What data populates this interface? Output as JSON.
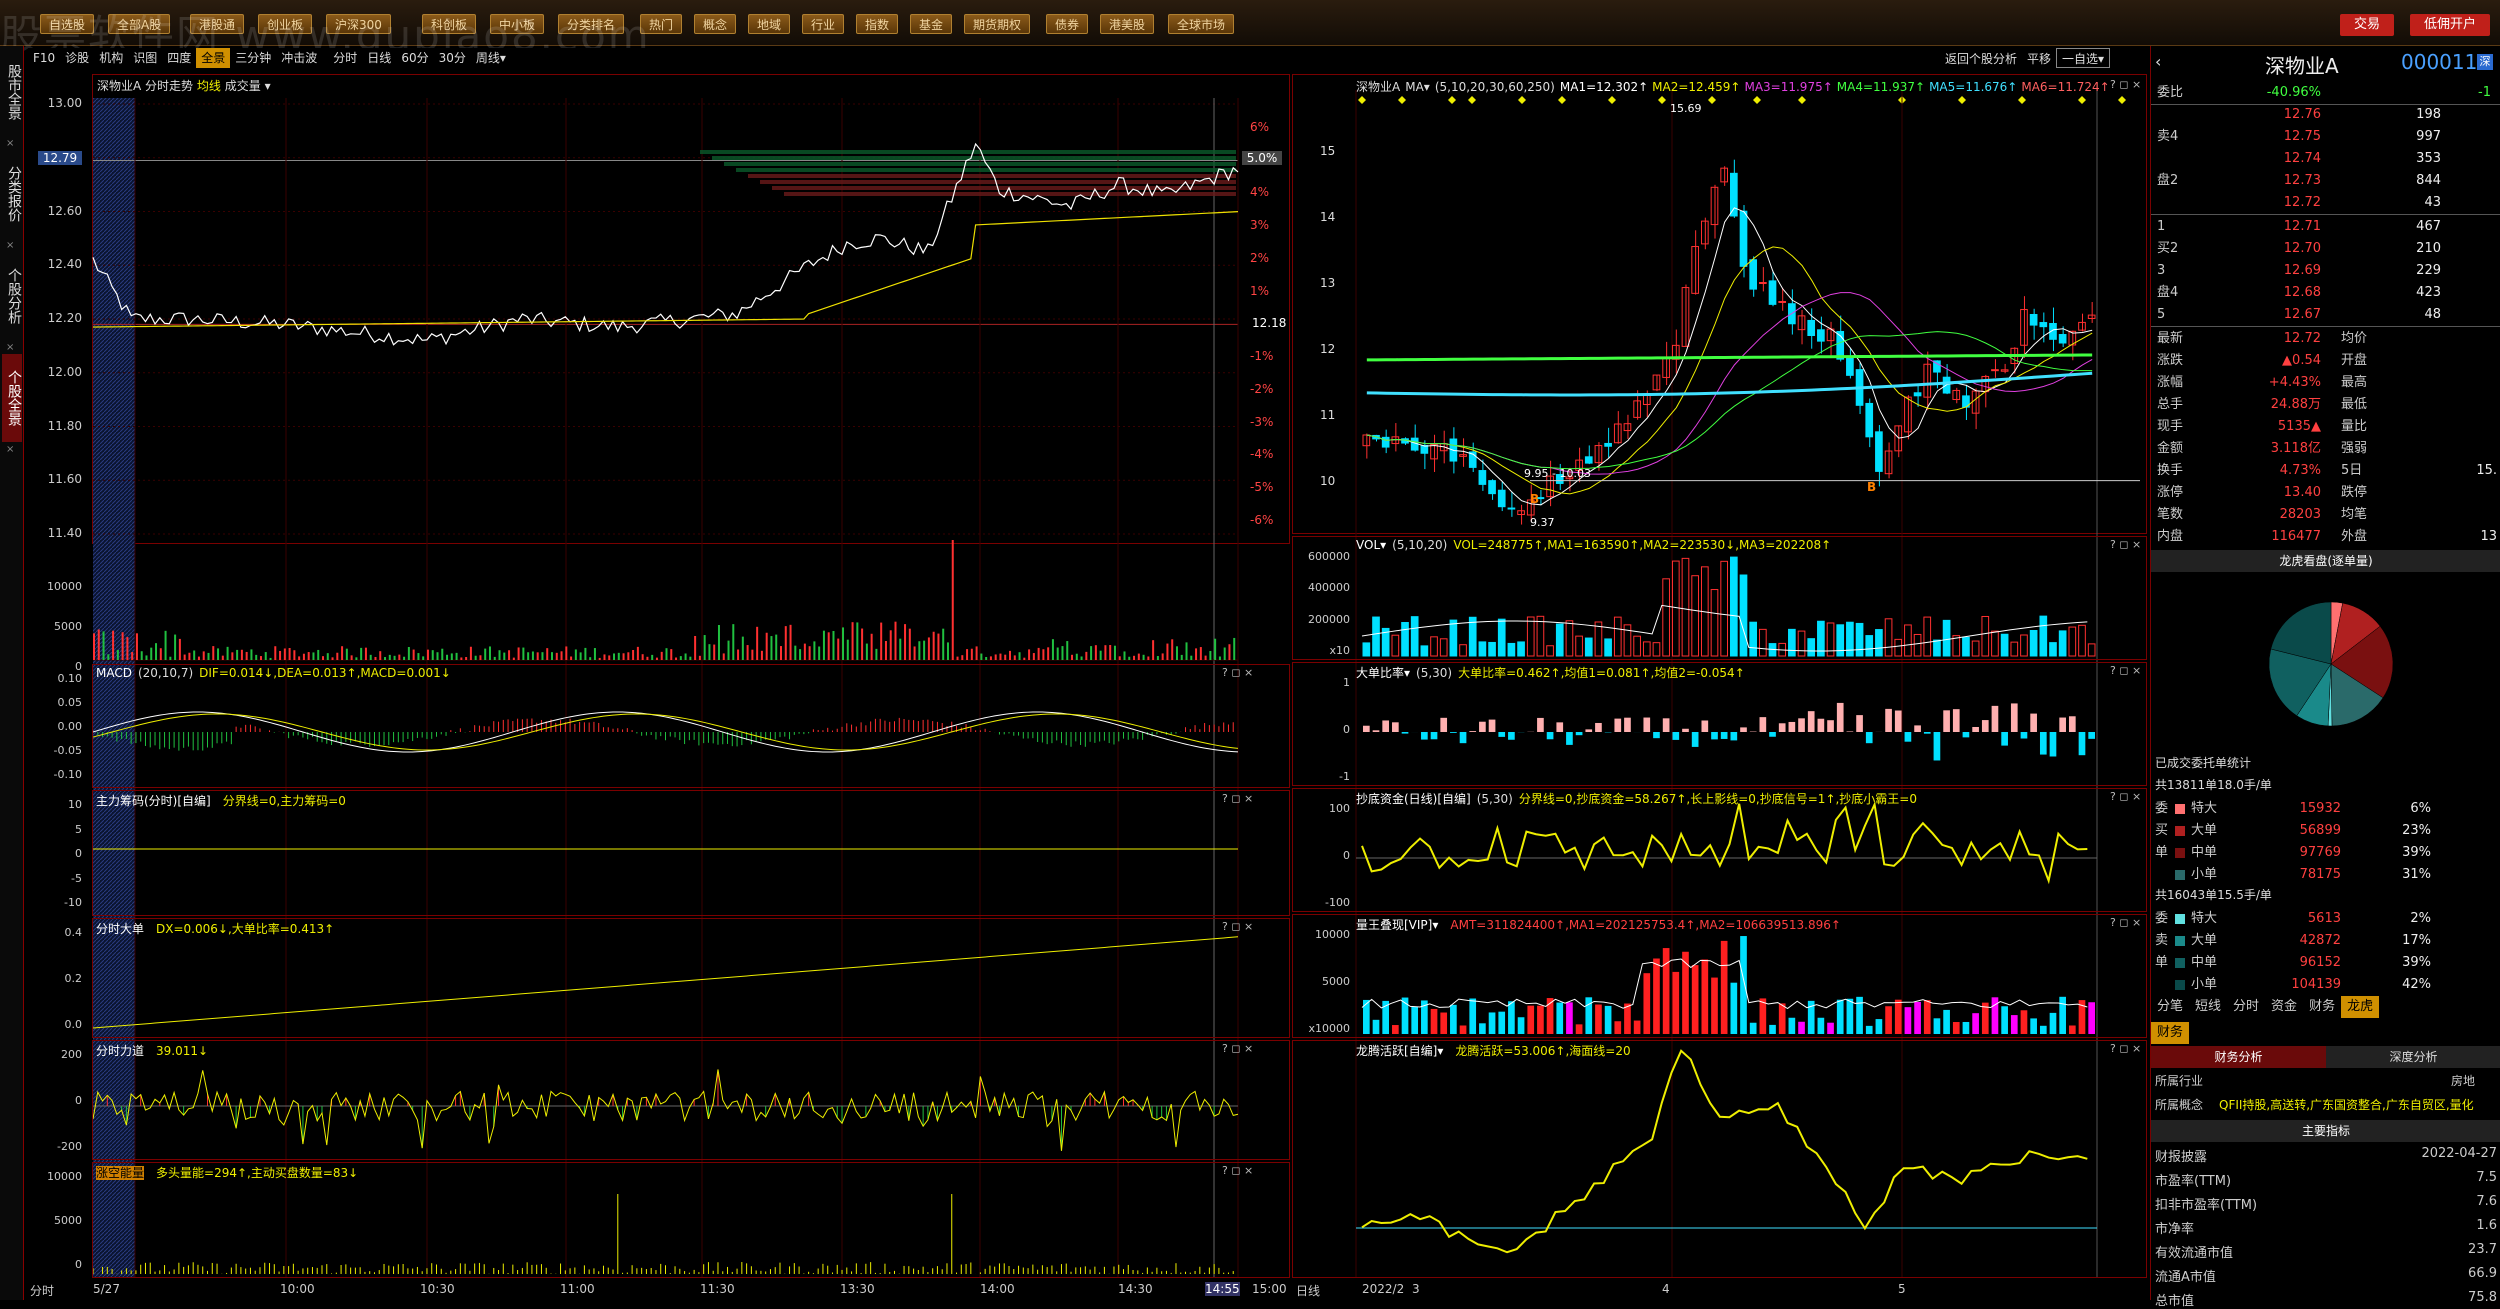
{
  "topbar": {
    "buttons": [
      "自选股",
      "全部A股",
      "港股通",
      "创业板",
      "沪深300",
      "科创板",
      "中小板",
      "分类排名",
      "热门",
      "概念",
      "地域",
      "行业",
      "指数",
      "基金",
      "期货期权",
      "债券",
      "港美股",
      "全球市场"
    ],
    "trade_btn": "交易",
    "margin_btn": "低佣开户",
    "watermark": "股票软件网 www.gupiao8.com"
  },
  "leftside": {
    "labels": [
      "股市全景",
      "分类报价",
      "个股分析",
      "个股全景"
    ]
  },
  "left_toolbar": {
    "items": [
      "F10",
      "诊股",
      "机构",
      "识图",
      "四度",
      "全景",
      "三分钟",
      "冲击波",
      "分时",
      "日线",
      "60分",
      "30分",
      "周线▾"
    ],
    "active": "全景"
  },
  "right_toolbar": {
    "items": [
      "返回个股分析",
      "平移",
      "一自选▾"
    ]
  },
  "intraday": {
    "title": "深物业A",
    "label_fenshi": "分时走势",
    "label_avg": "均线",
    "label_vol": "成交量",
    "y_left": [
      "13.00",
      "12.80",
      "12.60",
      "12.40",
      "12.20",
      "12.00",
      "11.80",
      "11.60",
      "11.40"
    ],
    "y_right": [
      "6%",
      "5%",
      "4%",
      "3%",
      "2%",
      "1%",
      "",
      "-1%",
      "-2%",
      "-3%",
      "-4%",
      "-5%",
      "-6%"
    ],
    "price_tag": "12.79",
    "pct_tag": "5.0%",
    "prev_close": "12.18",
    "vol_y": [
      "10000",
      "5000",
      "0"
    ],
    "time_axis": [
      "5/27",
      "10:00",
      "10:30",
      "11:00",
      "11:30",
      "13:30",
      "14:00",
      "14:30",
      "14:55",
      "15:00"
    ],
    "time_corner": "分时"
  },
  "sub_left": [
    {
      "name": "MACD",
      "params": "(20,10,7)",
      "vals": "DIF=0.014↓,DEA=0.013↑,MACD=0.001↓",
      "y": [
        "0.10",
        "0.05",
        "0.00",
        "-0.05",
        "-0.10"
      ]
    },
    {
      "name": "主力筹码(分时)[自编]",
      "params": "",
      "vals": "分界线=0,主力筹码=0",
      "y": [
        "10",
        "5",
        "0",
        "-5",
        "-10"
      ]
    },
    {
      "name": "分时大单",
      "params": "",
      "vals": "DX=0.006↓,大单比率=0.413↑",
      "y": [
        "0.4",
        "0.2",
        "0.0"
      ]
    },
    {
      "name": "分时力道",
      "params": "",
      "vals": "39.011↓",
      "y": [
        "200",
        "0",
        "-200"
      ]
    },
    {
      "name": "涨空能量",
      "params": "",
      "vals": "多头量能=294↑,主动买盘数量=83↓",
      "y": [
        "10000",
        "5000",
        "0"
      ]
    }
  ],
  "daily": {
    "title": "深物业A",
    "ma_label": "MA▾",
    "ma_params": "(5,10,20,30,60,250)",
    "ma_vals": [
      "MA1=12.302↑",
      "MA2=12.459↑",
      "MA3=11.975↑",
      "MA4=11.937↑",
      "MA5=11.676↑",
      "MA6=11.724↑"
    ],
    "y": [
      "15",
      "14",
      "13",
      "12",
      "11",
      "10"
    ],
    "hi_label": "15.69",
    "lo_label": "9.37",
    "mid_label": "9.95 - 10.03",
    "b_label": "B",
    "x_axis": [
      "2022/2",
      "3",
      "4",
      "5"
    ],
    "x_corner": "日线"
  },
  "sub_right": [
    {
      "name": "VOL▾",
      "params": "(5,10,20)",
      "vals": "VOL=248775↑,MA1=163590↑,MA2=223530↓,MA3=202208↑",
      "y": [
        "600000",
        "400000",
        "200000",
        "x10"
      ]
    },
    {
      "name": "大单比率▾",
      "params": "(5,30)",
      "vals": "大单比率=0.462↑,均值1=0.081↑,均值2=-0.054↑",
      "y": [
        "1",
        "0",
        "-1"
      ]
    },
    {
      "name": "抄底资金(日线)[自编]",
      "params": "(5,30)",
      "vals": "分界线=0,抄底资金=58.267↑,长上影线=0,抄底信号=1↑,抄底小霸王=0",
      "y": [
        "100",
        "0",
        "-100"
      ]
    },
    {
      "name": "量王叠现[VIP]▾",
      "params": "",
      "vals": "AMT=311824400↑,MA1=202125753.4↑,MA2=106639513.896↑",
      "y": [
        "10000",
        "5000",
        "x10000"
      ]
    },
    {
      "name": "龙腾活跃[自编]▾",
      "params": "",
      "vals": "龙腾活跃=53.006↑,海面线=20",
      "y": []
    }
  ],
  "quote": {
    "name": "深物业A",
    "code": "000011",
    "webi_label": "委比",
    "webi_val": "-40.96%",
    "webi_side": "-1",
    "sells": [
      {
        "l": "",
        "p": "12.76",
        "v": "198"
      },
      {
        "l": "卖4",
        "p": "12.75",
        "v": "997"
      },
      {
        "l": "",
        "p": "12.74",
        "v": "353"
      },
      {
        "l": "盘2",
        "p": "12.73",
        "v": "844"
      },
      {
        "l": "",
        "p": "12.72",
        "v": "43"
      }
    ],
    "buys": [
      {
        "l": "1",
        "p": "12.71",
        "v": "467"
      },
      {
        "l": "买2",
        "p": "12.70",
        "v": "210"
      },
      {
        "l": "3",
        "p": "12.69",
        "v": "229"
      },
      {
        "l": "盘4",
        "p": "12.68",
        "v": "423"
      },
      {
        "l": "5",
        "p": "12.67",
        "v": "48"
      }
    ],
    "stats": [
      {
        "a": "最新",
        "av": "12.72",
        "b": "均价",
        "bv": ""
      },
      {
        "a": "涨跌",
        "av": "▲0.54",
        "b": "开盘",
        "bv": ""
      },
      {
        "a": "涨幅",
        "av": "+4.43%",
        "b": "最高",
        "bv": ""
      },
      {
        "a": "总手",
        "av": "24.88万",
        "b": "最低",
        "bv": ""
      },
      {
        "a": "现手",
        "av": "5135▲",
        "b": "量比",
        "bv": ""
      },
      {
        "a": "金额",
        "av": "3.118亿",
        "b": "强弱",
        "bv": ""
      },
      {
        "a": "换手",
        "av": "4.73%",
        "b": "5日",
        "bv": "15."
      },
      {
        "a": "涨停",
        "av": "13.40",
        "b": "跌停",
        "bv": ""
      },
      {
        "a": "笔数",
        "av": "28203",
        "b": "均笔",
        "bv": ""
      },
      {
        "a": "内盘",
        "av": "116477",
        "b": "外盘",
        "bv": "13"
      }
    ],
    "dragon_title": "龙虎看盘(逐单量)",
    "done_title": "已成交委托单统计",
    "sell_total": "共13811单18.0手/单",
    "sell_rows": [
      {
        "s": "委",
        "k": "特大",
        "v": "15932",
        "p": "6%"
      },
      {
        "s": "买",
        "k": "大单",
        "v": "56899",
        "p": "23%"
      },
      {
        "s": "单",
        "k": "中单",
        "v": "97769",
        "p": "39%"
      },
      {
        "s": "",
        "k": "小单",
        "v": "78175",
        "p": "31%"
      }
    ],
    "buy_total": "共16043单15.5手/单",
    "buy_rows": [
      {
        "s": "委",
        "k": "特大",
        "v": "5613",
        "p": "2%"
      },
      {
        "s": "卖",
        "k": "大单",
        "v": "42872",
        "p": "17%"
      },
      {
        "s": "单",
        "k": "中单",
        "v": "96152",
        "p": "39%"
      },
      {
        "s": "",
        "k": "小单",
        "v": "104139",
        "p": "42%"
      }
    ],
    "tabs1": [
      "分笔",
      "短线",
      "分时",
      "资金",
      "财务",
      "龙虎"
    ],
    "tabs1_active": "龙虎",
    "tab_caiwu": "财务",
    "tab_fa": "财务分析",
    "tab_sd": "深度分析",
    "industry_label": "所属行业",
    "industry_val": "房地",
    "concept_label": "所属概念",
    "concept_val": "QFII持股,高送转,广东国资整合,广东自贸区,量化",
    "main_idx": "主要指标",
    "fin": [
      {
        "k": "财报披露",
        "v": "2022-04-27"
      },
      {
        "k": "市盈率(TTM)",
        "v": "7.5"
      },
      {
        "k": "扣非市盈率(TTM)",
        "v": "7.6"
      },
      {
        "k": "市净率",
        "v": "1.6"
      },
      {
        "k": "有效流通市值",
        "v": "23.7"
      },
      {
        "k": "流通A市值",
        "v": "66.9"
      },
      {
        "k": "总市值",
        "v": "75.8"
      }
    ]
  }
}
